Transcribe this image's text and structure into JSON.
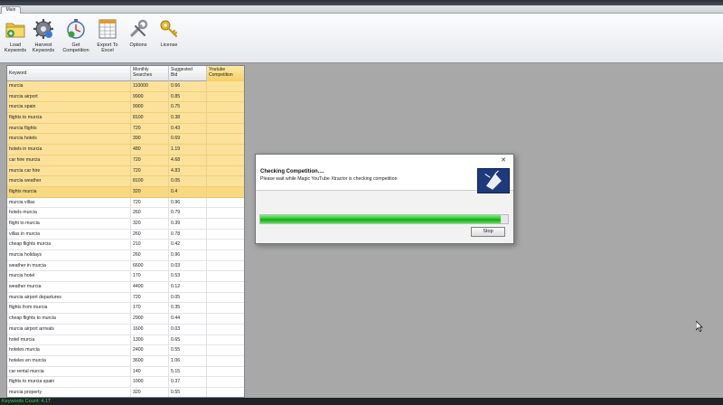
{
  "tab": {
    "label": "Main"
  },
  "toolbar": {
    "buttons": [
      {
        "id": "load",
        "label": "Load\nKeywords",
        "icon": "folder-icon"
      },
      {
        "id": "harvest",
        "label": "Harvest\nKeywords",
        "icon": "gear-icon"
      },
      {
        "id": "competition",
        "label": "Get\nCompetition",
        "icon": "stopwatch-icon"
      },
      {
        "id": "export",
        "label": "Export To\nExcel",
        "icon": "spreadsheet-icon"
      },
      {
        "id": "options",
        "label": "Options",
        "icon": "wrench-icon"
      },
      {
        "id": "license",
        "label": "License",
        "icon": "key-icon"
      }
    ]
  },
  "grid": {
    "headers": {
      "keyword": "Keyword",
      "monthly": "Monthly\nSearches",
      "bid": "Suggested\nBid",
      "youtube": "Youtube\nCompetition"
    },
    "rows": [
      {
        "keyword": "murcia",
        "monthly": "110000",
        "bid": "0.66",
        "youtube": "",
        "state": "hl"
      },
      {
        "keyword": "murcia airport",
        "monthly": "9900",
        "bid": "0.85",
        "youtube": "",
        "state": "hl"
      },
      {
        "keyword": "murcia spain",
        "monthly": "9900",
        "bid": "0.75",
        "youtube": "",
        "state": "hl"
      },
      {
        "keyword": "flights to murcia",
        "monthly": "8100",
        "bid": "0.38",
        "youtube": "",
        "state": "hl"
      },
      {
        "keyword": "murcia flights",
        "monthly": "720",
        "bid": "0.43",
        "youtube": "",
        "state": "hl"
      },
      {
        "keyword": "murcia hotels",
        "monthly": "390",
        "bid": "0.69",
        "youtube": "",
        "state": "hl"
      },
      {
        "keyword": "hotels in murcia",
        "monthly": "480",
        "bid": "1.19",
        "youtube": "",
        "state": "hl"
      },
      {
        "keyword": "car hire murcia",
        "monthly": "720",
        "bid": "4.68",
        "youtube": "",
        "state": "hl"
      },
      {
        "keyword": "murcia car hire",
        "monthly": "720",
        "bid": "4.83",
        "youtube": "",
        "state": "hl"
      },
      {
        "keyword": "murcia weather",
        "monthly": "8100",
        "bid": "0.05",
        "youtube": "",
        "state": "hl"
      },
      {
        "keyword": "flights murcia",
        "monthly": "320",
        "bid": "0.4",
        "youtube": "",
        "state": "sel"
      },
      {
        "keyword": "murcia villas",
        "monthly": "720",
        "bid": "0.96",
        "youtube": "",
        "state": ""
      },
      {
        "keyword": "hotels murcia",
        "monthly": "260",
        "bid": "0.79",
        "youtube": "",
        "state": ""
      },
      {
        "keyword": "flight to murcia",
        "monthly": "320",
        "bid": "0.39",
        "youtube": "",
        "state": ""
      },
      {
        "keyword": "villas in murcia",
        "monthly": "260",
        "bid": "0.78",
        "youtube": "",
        "state": ""
      },
      {
        "keyword": "cheap flights murcia",
        "monthly": "210",
        "bid": "0.42",
        "youtube": "",
        "state": ""
      },
      {
        "keyword": "murcia holidays",
        "monthly": "260",
        "bid": "0.96",
        "youtube": "",
        "state": ""
      },
      {
        "keyword": "weather in murcia",
        "monthly": "6600",
        "bid": "0.03",
        "youtube": "",
        "state": ""
      },
      {
        "keyword": "murcia hotel",
        "monthly": "170",
        "bid": "0.53",
        "youtube": "",
        "state": ""
      },
      {
        "keyword": "weather murcia",
        "monthly": "4400",
        "bid": "0.12",
        "youtube": "",
        "state": ""
      },
      {
        "keyword": "murcia airport departures",
        "monthly": "720",
        "bid": "0.05",
        "youtube": "",
        "state": ""
      },
      {
        "keyword": "flights from murcia",
        "monthly": "170",
        "bid": "0.35",
        "youtube": "",
        "state": ""
      },
      {
        "keyword": "cheap flights to murcia",
        "monthly": "2900",
        "bid": "0.44",
        "youtube": "",
        "state": ""
      },
      {
        "keyword": "murcia airport arrivals",
        "monthly": "1600",
        "bid": "0.03",
        "youtube": "",
        "state": ""
      },
      {
        "keyword": "hotel murcia",
        "monthly": "1300",
        "bid": "0.65",
        "youtube": "",
        "state": ""
      },
      {
        "keyword": "hoteles murcia",
        "monthly": "2400",
        "bid": "0.55",
        "youtube": "",
        "state": ""
      },
      {
        "keyword": "hoteles en murcia",
        "monthly": "3600",
        "bid": "1.06",
        "youtube": "",
        "state": ""
      },
      {
        "keyword": "car rental murcia",
        "monthly": "140",
        "bid": "5.15",
        "youtube": "",
        "state": ""
      },
      {
        "keyword": "flights to murcia spain",
        "monthly": "1000",
        "bid": "0.37",
        "youtube": "",
        "state": ""
      },
      {
        "keyword": "murcia property",
        "monthly": "320",
        "bid": "0.55",
        "youtube": "",
        "state": ""
      }
    ]
  },
  "status": {
    "text": "Keywords Count: 4.1T"
  },
  "dialog": {
    "close": "✕",
    "title": "Checking Competition....",
    "message": "Please wait while Magic YouTube Xtractor is checking competition",
    "progress": 0.97,
    "stop_label": "Stop"
  },
  "colors": {
    "highlight": "#fbe19a",
    "progress": "#24c524",
    "status_text": "#3fcf3f"
  }
}
